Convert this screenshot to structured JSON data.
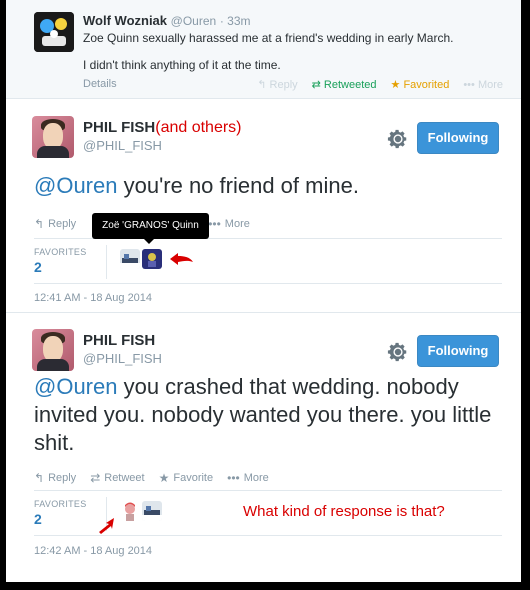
{
  "top_tweet": {
    "name": "Wolf Wozniak",
    "handle": "@Ouren",
    "time": "· 33m",
    "lines": [
      "Zoe Quinn sexually harassed me at a friend's wedding in early March.",
      "I didn't think anything of it at the time."
    ],
    "details": "Details",
    "actions": {
      "reply": "Reply",
      "retweeted": "Retweeted",
      "favorited": "Favorited",
      "more": "More"
    }
  },
  "tweet1": {
    "name": "PHIL FISH",
    "annotation": "(and others)",
    "handle": "@PHIL_FISH",
    "follow_label": "Following",
    "mention": "@Ouren",
    "text": " you're no friend of mine.",
    "actions": {
      "reply": "Reply",
      "more": "More"
    },
    "tooltip": "Zoë 'GRANOS' Quinn",
    "favorites_label": "FAVORITES",
    "favorites_count": "2",
    "timestamp": "12:41 AM - 18 Aug 2014"
  },
  "tweet2": {
    "name": "PHIL FISH",
    "handle": "@PHIL_FISH",
    "follow_label": "Following",
    "mention": "@Ouren",
    "text": " you crashed that wedding. nobody invited you. nobody wanted you there. you little shit.",
    "actions": {
      "reply": "Reply",
      "retweet": "Retweet",
      "favorite": "Favorite",
      "more": "More"
    },
    "favorites_label": "FAVORITES",
    "favorites_count": "2",
    "timestamp": "12:42 AM - 18 Aug 2014",
    "annotation": "What kind of response is that?"
  },
  "colors": {
    "link": "#2b7bb9",
    "follow_button": "#3b94d9",
    "annotation_red": "#d90000",
    "retweeted": "#19a05a",
    "favorited": "#e5a000"
  }
}
